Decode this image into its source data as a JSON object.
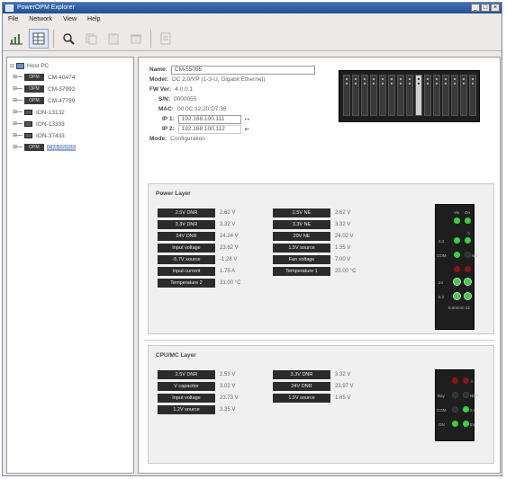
{
  "window": {
    "title": "PowerOPM Explorer"
  },
  "menu": [
    "File",
    "Network",
    "View",
    "Help"
  ],
  "toolbar": [
    "chart-icon",
    "table-icon",
    "search-device-icon",
    "copy-icon",
    "paste-icon",
    "delete-icon",
    "list-icon"
  ],
  "tree": {
    "root": "Host PC",
    "items": [
      {
        "chip": "OPM",
        "label": "CM-40474",
        "selected": false
      },
      {
        "chip": "OPM",
        "label": "CM-37992",
        "selected": false
      },
      {
        "chip": "OPM",
        "label": "CM-47789",
        "selected": false
      },
      {
        "chip": "",
        "label": "ION-13132",
        "selected": false
      },
      {
        "chip": "",
        "label": "ION-13333",
        "selected": false
      },
      {
        "chip": "",
        "label": "ION-37433",
        "selected": false
      },
      {
        "chip": "OPM",
        "label": "CM-55055",
        "selected": true
      }
    ]
  },
  "info": {
    "name_label": "Name:",
    "name_value": "CM-55055",
    "model_label": "Model:",
    "model_value": "DC 2.0/VP (1-3-U, Gigabit Ethernet)",
    "fw_label": "FW Ver:",
    "fw_value": "4.0.0.1",
    "sn_label": "S/N:",
    "sn_value": "0000055",
    "mac_label": "MAC:",
    "mac_value": "00:0C:12:20:D7:36",
    "ip1_label": "IP 1:",
    "ip1_value": "192.168.100.111",
    "ip2_label": "IP 2:",
    "ip2_value": "192.168.100.112",
    "mode_label": "Mode:",
    "mode_value": "Configuration"
  },
  "power_layer": {
    "title": "Power Layer",
    "left": [
      {
        "label": "2.5V DNR",
        "value": "2.62 V"
      },
      {
        "label": "3.3V DNR",
        "value": "3.32 V"
      },
      {
        "label": "24V DNR",
        "value": "24.24 V"
      },
      {
        "label": "Input voltage",
        "value": "23.62 V"
      },
      {
        "label": "-5.7V source",
        "value": "-1.28 V"
      },
      {
        "label": "Input current",
        "value": "1.75 A"
      },
      {
        "label": "Temperature 2",
        "value": "31.00 °C"
      }
    ],
    "right": [
      {
        "label": "2.5V NE",
        "value": "2.62 V"
      },
      {
        "label": "3.3V NE",
        "value": "3.32 V"
      },
      {
        "label": "20V NE",
        "value": "24.02 V"
      },
      {
        "label": "1.5V source",
        "value": "1.55 V"
      },
      {
        "label": "Fan voltage",
        "value": "7.00 V"
      },
      {
        "label": "Temperature 1",
        "value": "25.00 °C"
      }
    ],
    "leds": {
      "top_labels": [
        "Vin",
        "On"
      ],
      "side_left": [
        "3.3",
        "COM",
        "2.5",
        "24",
        "5.2"
      ],
      "side_right": [
        "ALM",
        "NO",
        "NE",
        "24",
        "5.2"
      ],
      "bottom_label": "5.6mmm 12"
    }
  },
  "cpu_layer": {
    "title": "CPU/MC Layer",
    "left": [
      {
        "label": "2.5V DNR",
        "value": "2.53 V"
      },
      {
        "label": "V capacitor",
        "value": "3.02 V"
      },
      {
        "label": "Input voltage",
        "value": "23.73 V"
      },
      {
        "label": "1.2V source",
        "value": "3.35 V"
      }
    ],
    "right": [
      {
        "label": "3.3V DNR",
        "value": "3.32 V"
      },
      {
        "label": "24V DNR",
        "value": "23.97 V"
      },
      {
        "label": "1.5V source",
        "value": "1.65 V"
      }
    ],
    "leds": {
      "side_left": [
        "Bay",
        "COM",
        "ON"
      ],
      "side_right": [
        "ALM",
        "NBR",
        "2.5",
        "5V"
      ]
    }
  }
}
